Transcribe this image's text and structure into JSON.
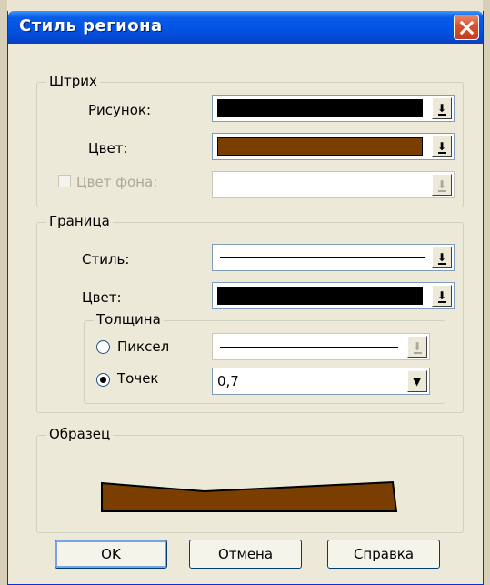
{
  "window": {
    "title": "Стиль региона"
  },
  "hatch": {
    "group_label": "Штрих",
    "pattern_label": "Рисунок:",
    "pattern_color": "#000000",
    "color_label": "Цвет:",
    "color_value": "#7a3f00",
    "bg_color_label": "Цвет фона:",
    "bg_color_checked": false
  },
  "border": {
    "group_label": "Граница",
    "style_label": "Стиль:",
    "color_label": "Цвет:",
    "color_value": "#000000",
    "thickness": {
      "group_label": "Толщина",
      "pixel_label": "Пиксел",
      "points_label": "Точек",
      "points_value": "0,7",
      "selected": "points"
    }
  },
  "sample": {
    "group_label": "Образец",
    "fill_color": "#7a3f00"
  },
  "buttons": {
    "ok": "OK",
    "cancel": "Отмена",
    "help": "Справка"
  },
  "icons": [
    "close-icon",
    "dropdown-arrow-icon"
  ]
}
